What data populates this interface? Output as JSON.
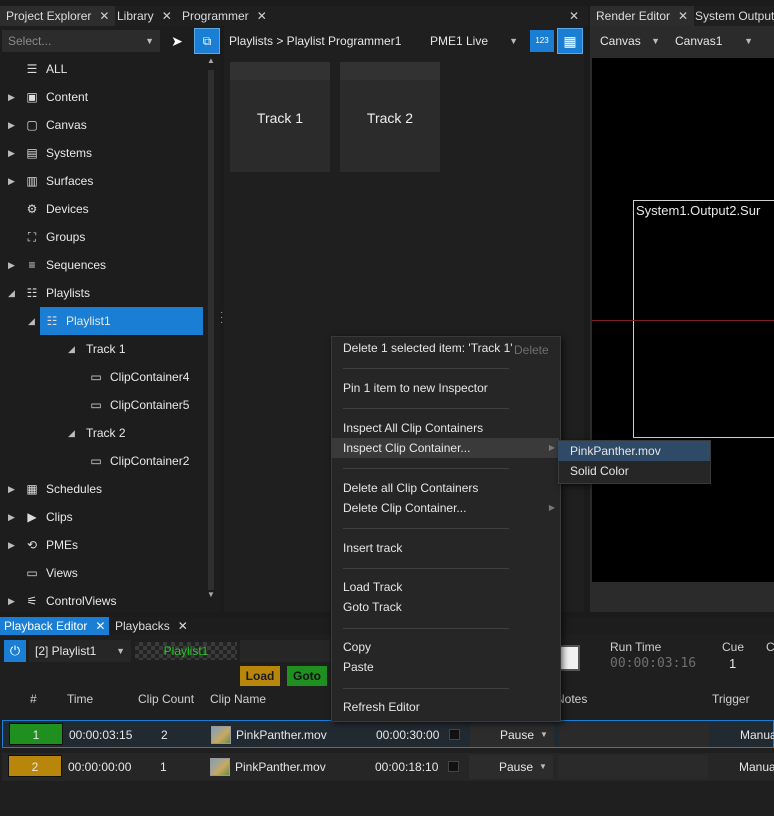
{
  "left_tabs": [
    {
      "label": "Project Explorer"
    },
    {
      "label": "Library"
    },
    {
      "label": "Programmer"
    }
  ],
  "right_tabs": [
    {
      "label": "Render Editor"
    },
    {
      "label": "System Output"
    }
  ],
  "explorer": {
    "select_placeholder": "Select...",
    "items": [
      {
        "label": "ALL",
        "icon": "database-icon"
      },
      {
        "label": "Content",
        "icon": "content-icon"
      },
      {
        "label": "Canvas",
        "icon": "canvas-icon"
      },
      {
        "label": "Systems",
        "icon": "systems-icon"
      },
      {
        "label": "Surfaces",
        "icon": "surfaces-icon"
      },
      {
        "label": "Devices",
        "icon": "devices-icon"
      },
      {
        "label": "Groups",
        "icon": "groups-icon"
      },
      {
        "label": "Sequences",
        "icon": "sequences-icon"
      },
      {
        "label": "Playlists",
        "icon": "playlists-icon"
      },
      {
        "label": "Playlist1",
        "icon": "playlist-icon"
      },
      {
        "label": "Track 1",
        "icon": ""
      },
      {
        "label": "ClipContainer4",
        "icon": "clip-container-icon"
      },
      {
        "label": "ClipContainer5",
        "icon": "clip-container-icon"
      },
      {
        "label": "Track 2",
        "icon": ""
      },
      {
        "label": "ClipContainer2",
        "icon": "clip-container-icon"
      },
      {
        "label": "Schedules",
        "icon": "schedules-icon"
      },
      {
        "label": "Clips",
        "icon": "clips-icon"
      },
      {
        "label": "PMEs",
        "icon": "pmes-icon"
      },
      {
        "label": "Views",
        "icon": "views-icon"
      },
      {
        "label": "ControlViews",
        "icon": "controlviews-icon"
      }
    ]
  },
  "programmer": {
    "breadcrumb": "Playlists > Playlist Programmer1",
    "pme": "PME1 Live",
    "num_icon_label": "123",
    "tracks": [
      {
        "label": "Track 1"
      },
      {
        "label": "Track 2"
      }
    ]
  },
  "render": {
    "canvas_type": "Canvas",
    "canvas_name": "Canvas1",
    "output_label": "System1.Output2.Sur"
  },
  "context_menu": {
    "items": [
      {
        "label": "Delete 1 selected item: 'Track 1'",
        "shortcut": "Delete"
      },
      {
        "label": "Pin 1 item to new Inspector"
      },
      {
        "label": "Inspect All Clip Containers"
      },
      {
        "label": "Inspect Clip Container..."
      },
      {
        "label": "Delete all Clip Containers"
      },
      {
        "label": "Delete Clip Container..."
      },
      {
        "label": "Insert track"
      },
      {
        "label": "Load Track"
      },
      {
        "label": "Goto Track"
      },
      {
        "label": "Copy"
      },
      {
        "label": "Paste"
      },
      {
        "label": "Refresh Editor"
      }
    ]
  },
  "submenu": {
    "items": [
      {
        "label": "PinkPanther.mov"
      },
      {
        "label": "Solid Color"
      }
    ]
  },
  "bottom_tabs": [
    {
      "label": "Playback Editor"
    },
    {
      "label": "Playbacks"
    }
  ],
  "playback": {
    "playlist": "[2] Playlist1",
    "active_label": "Playlist1",
    "load_label": "Load",
    "goto_label": "Goto",
    "run_time_label": "Run Time",
    "run_time": "00:00:03:16",
    "cue_label": "Cue",
    "cue": "1",
    "columns": [
      "#",
      "Time",
      "Clip Count",
      "Clip Name",
      "Notes",
      "Trigger"
    ],
    "rows": [
      {
        "num": "1",
        "time": "00:00:03:15",
        "count": "2",
        "clip": "PinkPanther.mov",
        "duration": "00:00:30:00",
        "action": "Pause",
        "trigger": "Manua"
      },
      {
        "num": "2",
        "time": "00:00:00:00",
        "count": "1",
        "clip": "PinkPanther.mov",
        "duration": "00:00:18:10",
        "action": "Pause",
        "trigger": "Manua"
      }
    ]
  },
  "colors": {
    "accent": "#1a7fd4",
    "green": "#1f8f1f",
    "gold": "#b8860b",
    "active_green": "#27c427"
  }
}
